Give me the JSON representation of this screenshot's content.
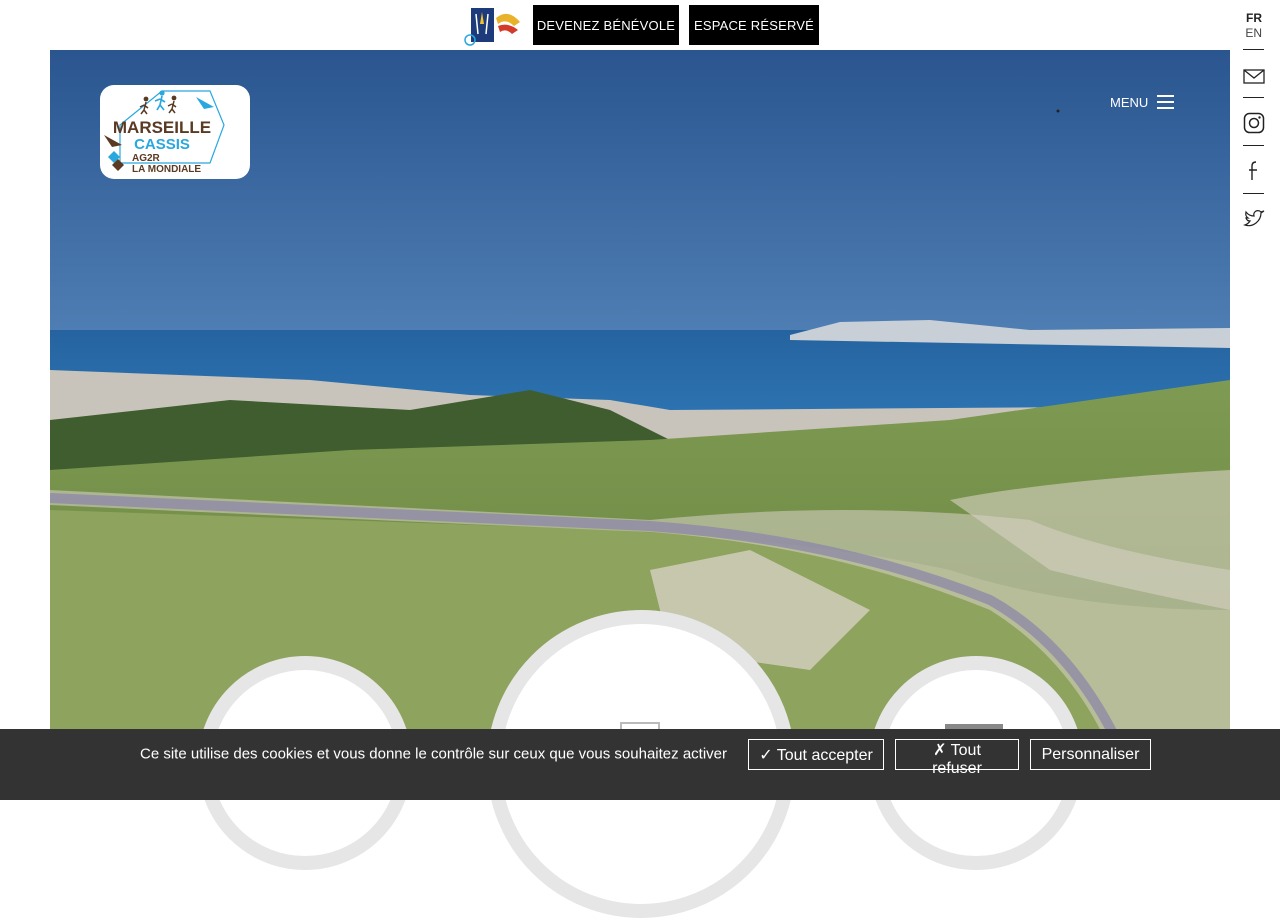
{
  "header": {
    "organizer_logo": "cassis-organizer-logo",
    "volunteer_button": "DEVENEZ BÉNÉVOLE",
    "reserved_button": "ESPACE RÉSERVÉ"
  },
  "side": {
    "languages": [
      "FR",
      "EN"
    ],
    "active_language": "FR",
    "icons": [
      "mail-icon",
      "instagram-icon",
      "facebook-icon",
      "twitter-icon"
    ]
  },
  "hero": {
    "logo": {
      "line1": "MARSEILLE",
      "line2": "CASSIS",
      "line3": "AG2R",
      "line4": "LA MONDIALE"
    },
    "menu_label": "MENU"
  },
  "cookie_banner": {
    "text": "Ce site utilise des cookies et vous donne le contrôle sur ceux que vous souhaitez activer",
    "accept": "✓ Tout accepter",
    "refuse": "✗ Tout refuser",
    "customize": "Personnaliser"
  },
  "colors": {
    "brand_brown": "#5a3a22",
    "brand_blue": "#29a8e0",
    "sky": "#2f5f9a",
    "sea": "#1e5f9b",
    "cookie_bg": "#333333"
  }
}
